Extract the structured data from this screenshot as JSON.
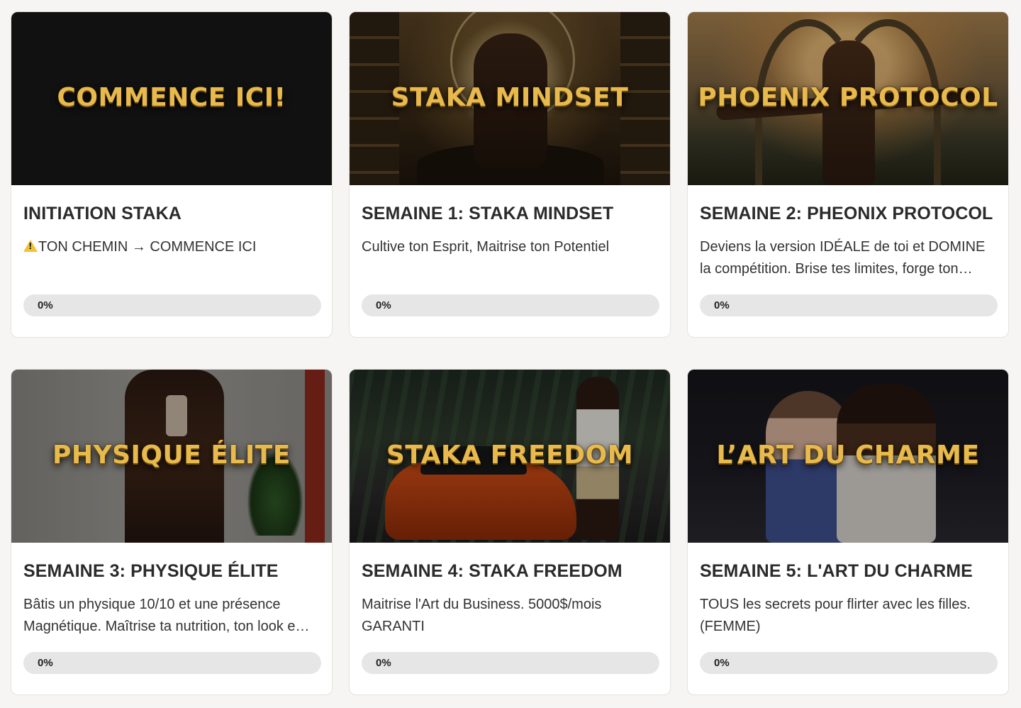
{
  "courses": [
    {
      "banner": "COMMENCE ICI!",
      "title": "INITIATION STAKA",
      "description": "TON CHEMIN → COMMENCE ICI",
      "description_icon": "warning-icon",
      "progress_label": "0%",
      "progress": 0
    },
    {
      "banner": "STAKA MINDSET",
      "title": "SEMAINE 1: STAKA MINDSET",
      "description": "Cultive ton Esprit, Maitrise ton Potentiel",
      "progress_label": "0%",
      "progress": 0
    },
    {
      "banner": "PHOENIX PROTOCOL",
      "title": "SEMAINE 2: PHEONIX PROTOCOL",
      "description": "Deviens la version IDÉALE de toi et DOMINE la compétition. Brise tes limites, forge ton…",
      "progress_label": "0%",
      "progress": 0
    },
    {
      "banner": "PHYSIQUE ÉLITE",
      "title": "SEMAINE 3: PHYSIQUE ÉLITE",
      "description": "Bâtis un physique 10/10 et une présence Magnétique. Maîtrise ta nutrition, ton look e…",
      "progress_label": "0%",
      "progress": 0
    },
    {
      "banner": "STAKA FREEDOM",
      "title": "SEMAINE 4: STAKA FREEDOM",
      "description": "Maitrise l'Art du Business. 5000$/mois GARANTI",
      "progress_label": "0%",
      "progress": 0
    },
    {
      "banner": "L’ART DU CHARME",
      "title": "SEMAINE 5: L'ART DU CHARME",
      "description": "TOUS les secrets pour flirter avec les filles. (FEMME)",
      "progress_label": "0%",
      "progress": 0
    }
  ],
  "colors": {
    "background": "#f6f5f3",
    "banner_text": "#e8b94c",
    "progress_track": "#e6e6e6",
    "title_text": "#2b2b2b"
  }
}
